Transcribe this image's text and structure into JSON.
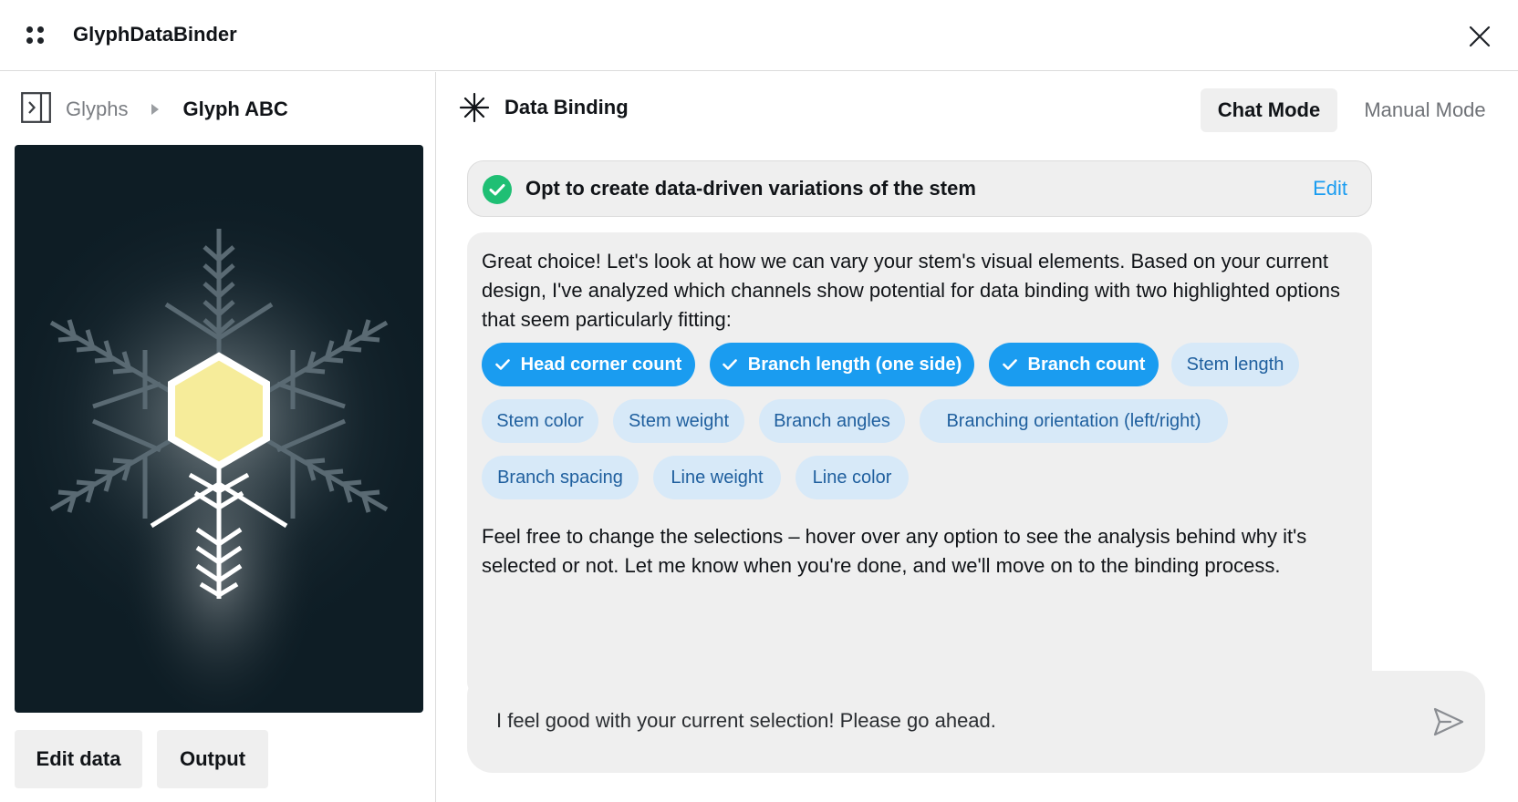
{
  "app": {
    "title": "GlyphDataBinder"
  },
  "left": {
    "breadcrumb": {
      "root": "Glyphs",
      "current": "Glyph ABC"
    },
    "buttons": {
      "edit_data": "Edit data",
      "output": "Output"
    }
  },
  "right": {
    "title": "Data Binding",
    "modes": {
      "chat": "Chat Mode",
      "manual": "Manual Mode"
    },
    "confirmed": {
      "text": "Opt to create data-driven variations of the stem",
      "edit": "Edit"
    },
    "message": {
      "intro": "Great choice! Let's look at how we can vary your stem's visual elements. Based on your current design, I've analyzed which channels show potential for data binding with two highlighted options that seem particularly fitting:",
      "chips": [
        {
          "label": "Head corner count",
          "selected": true
        },
        {
          "label": "Branch length (one side)",
          "selected": true
        },
        {
          "label": "Branch count",
          "selected": true
        },
        {
          "label": "Stem length",
          "selected": false
        },
        {
          "label": "Stem color",
          "selected": false
        },
        {
          "label": "Stem weight",
          "selected": false
        },
        {
          "label": "Branch angles",
          "selected": false
        },
        {
          "label": "Branching orientation (left/right)",
          "selected": false
        },
        {
          "label": "Branch spacing",
          "selected": false
        },
        {
          "label": "Line weight",
          "selected": false
        },
        {
          "label": "Line color",
          "selected": false
        }
      ],
      "outro": "Feel free to change the selections – hover over any option to see the analysis behind why it's selected or not. Let me know when you're done, and we'll move on to the binding process."
    },
    "composer": {
      "value": "I feel good with your current selection! Please go ahead."
    }
  },
  "colors": {
    "accent": "#1a9cf0",
    "chip_unselected_bg": "#d7e9f8",
    "success": "#1fbf74",
    "preview_bg": "#0e1d25",
    "hexagon_fill": "#f6ec9a"
  },
  "icons": [
    "app-grid-icon",
    "close-icon",
    "sidebar-toggle-icon",
    "asterisk-icon",
    "check-circle-icon",
    "check-icon",
    "send-icon"
  ]
}
